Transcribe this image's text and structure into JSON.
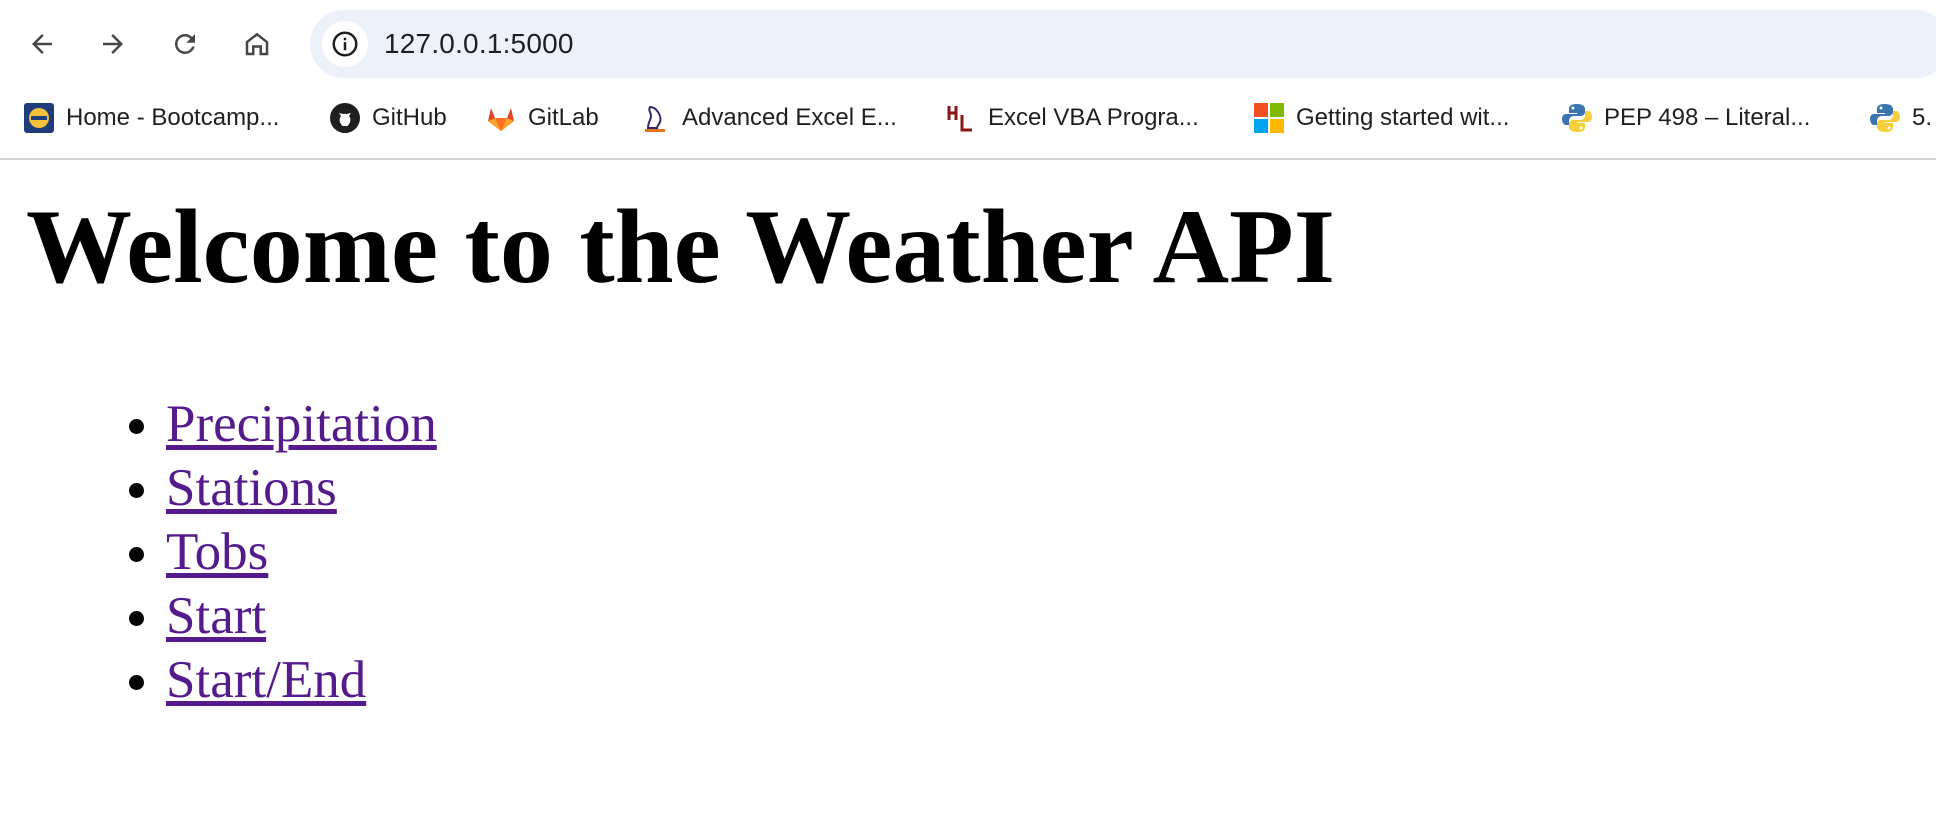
{
  "browser": {
    "url": "127.0.0.1:5000",
    "bookmarks": [
      {
        "label": "Home - Bootcamp...",
        "icon": "bootcamp-favicon"
      },
      {
        "label": "GitHub",
        "icon": "github-favicon"
      },
      {
        "label": "GitLab",
        "icon": "gitlab-favicon"
      },
      {
        "label": "Advanced Excel E...",
        "icon": "excel-course-favicon"
      },
      {
        "label": "Excel VBA Progra...",
        "icon": "hl-favicon"
      },
      {
        "label": "Getting started wit...",
        "icon": "microsoft-favicon"
      },
      {
        "label": "PEP 498 – Literal...",
        "icon": "python-favicon"
      },
      {
        "label": "5.",
        "icon": "python-favicon"
      }
    ]
  },
  "page": {
    "title": "Welcome to the Weather API",
    "links": [
      {
        "label": "Precipitation"
      },
      {
        "label": "Stations"
      },
      {
        "label": "Tobs"
      },
      {
        "label": "Start"
      },
      {
        "label": "Start/End"
      }
    ]
  },
  "colors": {
    "visited_link": "#551a8b",
    "omnibox_bg": "#edf2fa",
    "heading": "#000000"
  }
}
